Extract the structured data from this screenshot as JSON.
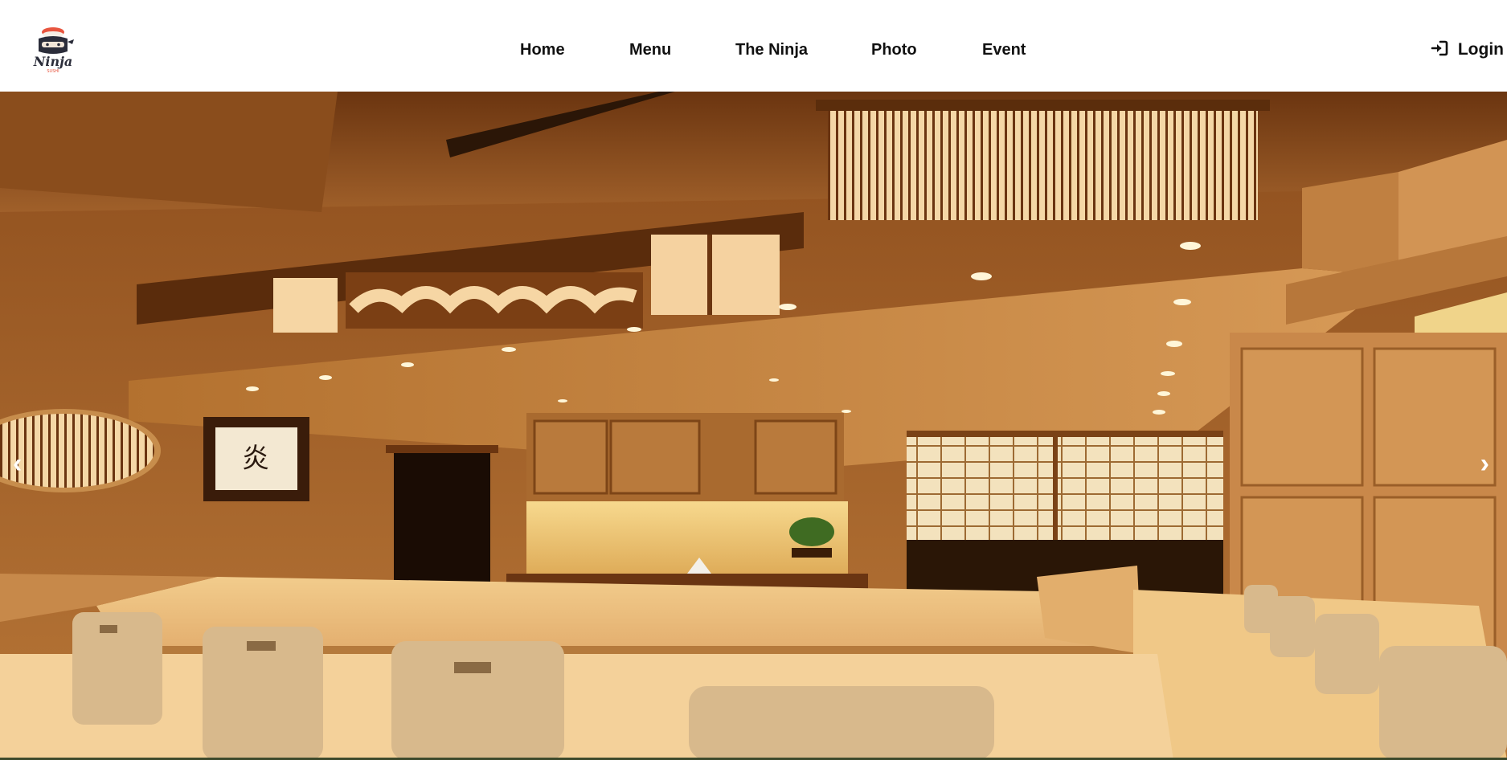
{
  "brand": {
    "logo_text": "Ninja",
    "logo_subtext": "SUSHI"
  },
  "nav": {
    "items": [
      {
        "label": "Home"
      },
      {
        "label": "Menu"
      },
      {
        "label": "The Ninja"
      },
      {
        "label": "Photo"
      },
      {
        "label": "Event"
      }
    ]
  },
  "auth": {
    "login_label": "Login",
    "icon": "sign-in-icon"
  },
  "hero": {
    "prev_label": "‹",
    "next_label": "›",
    "calligraphy": "炎",
    "image_subject": "sushi-restaurant-interior"
  },
  "colors": {
    "nav_text": "#111111",
    "wood_dark": "#7a3f12",
    "wood_light": "#f0cd97"
  }
}
